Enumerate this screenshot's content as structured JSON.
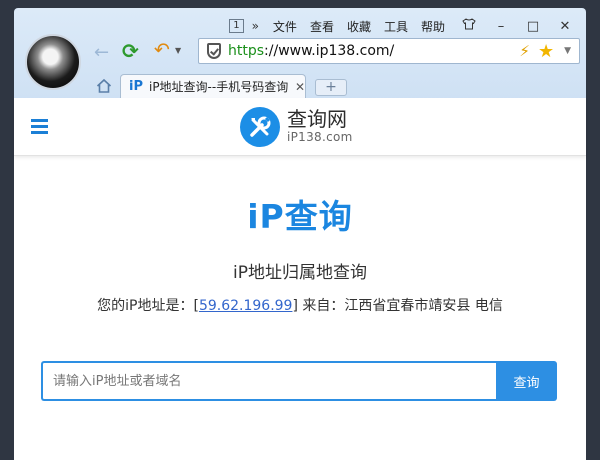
{
  "browser": {
    "menu": {
      "page_indicator": "1",
      "more": "»",
      "items": [
        "文件",
        "查看",
        "收藏",
        "工具",
        "帮助"
      ],
      "skin_icon": "shirt-icon"
    },
    "window_controls": {
      "minimize": "–",
      "maximize": "□",
      "close": "✕"
    },
    "address": {
      "scheme": "https",
      "rest": "://www.ip138.com/"
    },
    "tab": {
      "favicon": "iP",
      "title": "iP地址查询--手机号码查询",
      "close": "✕"
    },
    "new_tab": "+"
  },
  "site": {
    "logo": {
      "name": "查询网",
      "domain": "iP138.com"
    },
    "hero_title": "iP查询",
    "subtitle": "iP地址归属地查询",
    "ip_prefix": "您的iP地址是：[",
    "ip_address": "59.62.196.99",
    "ip_suffix": "] 来自：江西省宜春市靖安县 电信",
    "search": {
      "placeholder": "请输入iP地址或者域名",
      "value": "",
      "button_label": "查询"
    }
  },
  "colors": {
    "brand_blue": "#1b86e0",
    "button_blue": "#2d8fe3",
    "chrome_bg": "#d6e6f6",
    "secure_green": "#1a8f1a"
  }
}
